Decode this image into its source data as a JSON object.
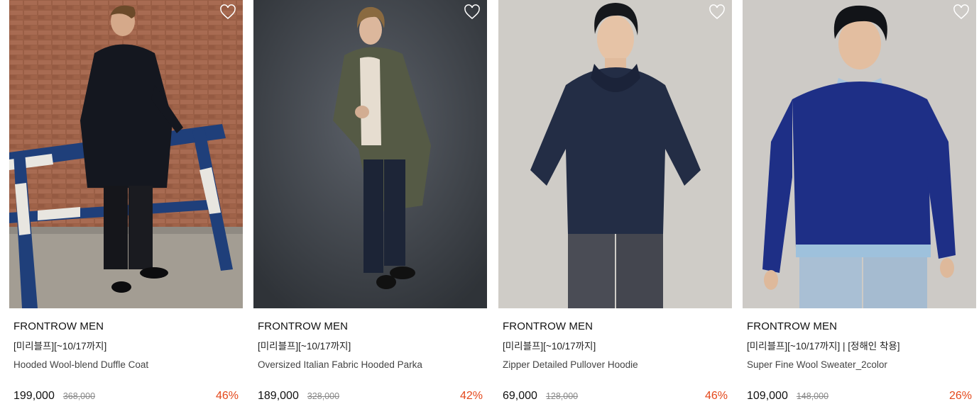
{
  "colors": {
    "accent_discount": "#e4481b",
    "text_primary": "#111111",
    "text_secondary": "#444444",
    "text_strike": "#888888"
  },
  "products": [
    {
      "brand": "FRONTROW MEN",
      "promo": "[미리블프][~10/17까지]",
      "name": "Hooded Wool-blend Duffle Coat",
      "price": "199,000",
      "original_price": "368,000",
      "discount": "46%",
      "wishlist_icon": "heart-outline-icon"
    },
    {
      "brand": "FRONTROW MEN",
      "promo": "[미리블프][~10/17까지]",
      "name": "Oversized Italian Fabric Hooded Parka",
      "price": "189,000",
      "original_price": "328,000",
      "discount": "42%",
      "wishlist_icon": "heart-outline-icon"
    },
    {
      "brand": "FRONTROW MEN",
      "promo": "[미리블프][~10/17까지]",
      "name": "Zipper Detailed Pullover Hoodie",
      "price": "69,000",
      "original_price": "128,000",
      "discount": "46%",
      "wishlist_icon": "heart-outline-icon"
    },
    {
      "brand": "FRONTROW MEN",
      "promo": "[미리블프][~10/17까지] | [정해인 착용]",
      "name": "Super Fine Wool Sweater_2color",
      "price": "109,000",
      "original_price": "148,000",
      "discount": "26%",
      "wishlist_icon": "heart-outline-icon"
    }
  ]
}
